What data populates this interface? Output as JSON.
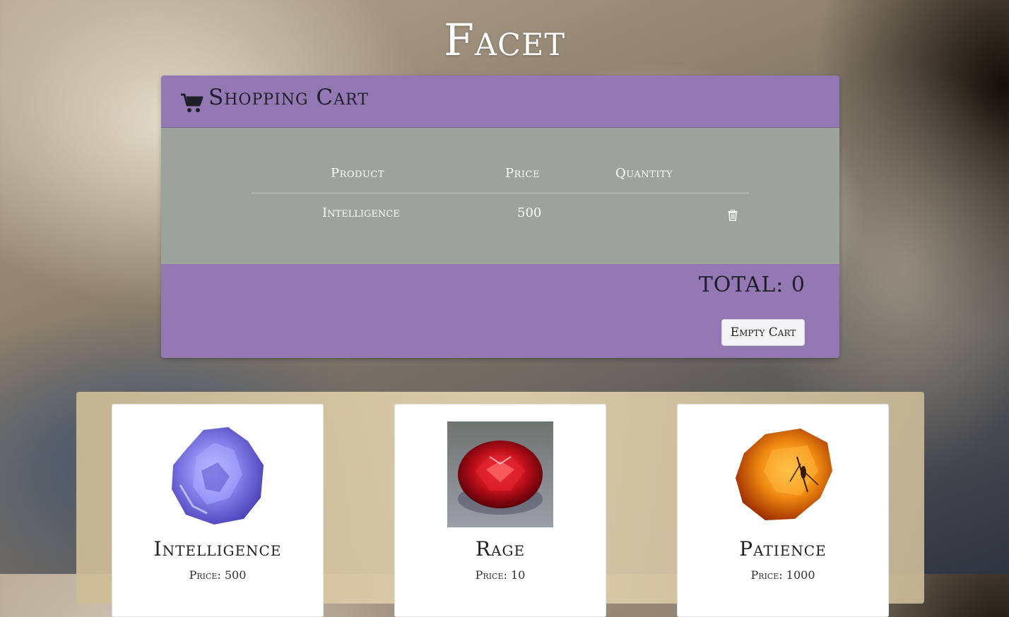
{
  "app": {
    "title": "Facet"
  },
  "cart": {
    "title": "Shopping Cart",
    "columns": {
      "product": "Product",
      "price": "Price",
      "quantity": "Quantity"
    },
    "items": [
      {
        "product": "Intelligence",
        "price": "500",
        "quantity": ""
      }
    ],
    "total_label": "TOTAL:",
    "total_value": "0",
    "empty_button": "Empty Cart"
  },
  "products": [
    {
      "name": "Intelligence",
      "price": "Price: 500",
      "gem": "tanzanite-blue"
    },
    {
      "name": "Rage",
      "price": "Price: 10",
      "gem": "ruby-red"
    },
    {
      "name": "Patience",
      "price": "Price: 1000",
      "gem": "amber"
    }
  ],
  "colors": {
    "header_purple": "#9378b4",
    "body_gray": "#9ca39b"
  }
}
